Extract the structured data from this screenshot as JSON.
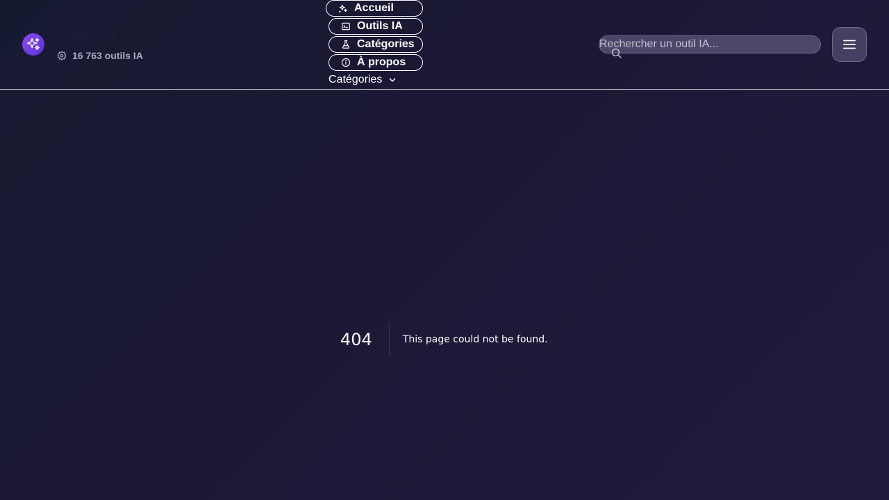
{
  "header": {
    "brand": {
      "name": "Neo-IA",
      "count_label": "16 763 outils IA",
      "logo_icon": "sparkles-icon",
      "count_icon": "badge-icon",
      "logo_color": "#7a42ea"
    },
    "nav": {
      "home_label": "Accueil",
      "tools_label": "Outils IA",
      "categories_label": "Catégories",
      "about_label": "À propos",
      "dropdown_label": "Catégories"
    },
    "search": {
      "placeholder": "Rechercher un outil IA..."
    },
    "menu": {
      "icon": "hamburger-icon"
    }
  },
  "error": {
    "code": "404",
    "message": "This page could not be found."
  }
}
